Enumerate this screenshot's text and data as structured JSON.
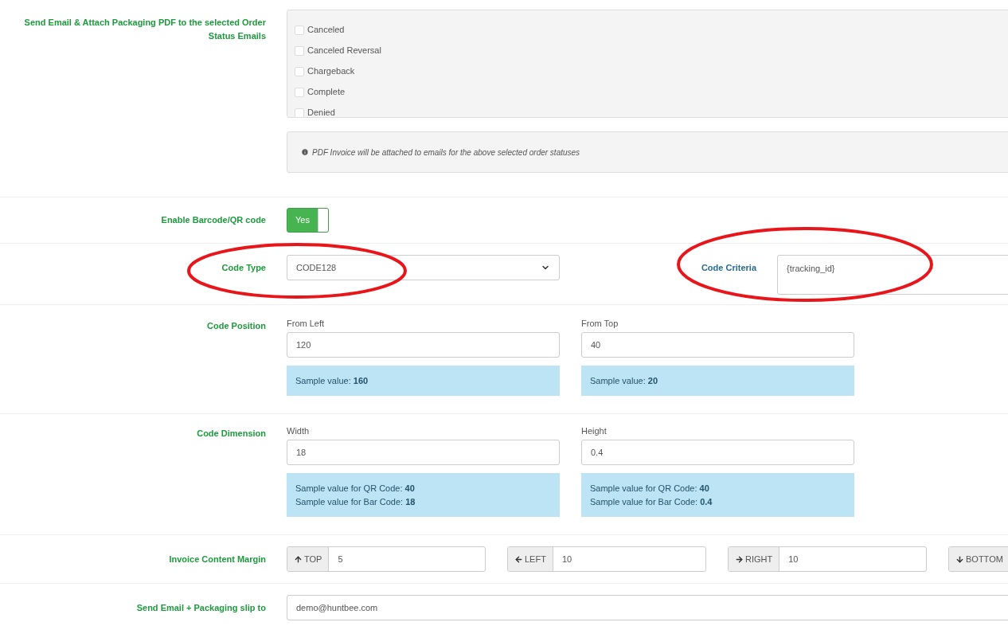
{
  "order_status_emails": {
    "label": "Send Email & Attach Packaging PDF to the selected Order Status Emails",
    "statuses": [
      {
        "label": "Canceled",
        "checked": false
      },
      {
        "label": "Canceled Reversal",
        "checked": false
      },
      {
        "label": "Chargeback",
        "checked": false
      },
      {
        "label": "Complete",
        "checked": false
      },
      {
        "label": "Denied",
        "checked": false
      }
    ],
    "info": "PDF Invoice will be attached to emails for the above selected order statuses"
  },
  "enable_barcode": {
    "label": "Enable Barcode/QR code",
    "toggle_text": "Yes",
    "on": true
  },
  "code_type": {
    "label": "Code Type",
    "value": "CODE128",
    "circled": true
  },
  "code_criteria": {
    "label": "Code Criteria",
    "value": "{tracking_id}",
    "circled": true
  },
  "code_position": {
    "label": "Code Position",
    "fields": [
      {
        "label": "From Left",
        "value": "120",
        "hints": [
          "Sample value: **160**"
        ]
      },
      {
        "label": "From Top",
        "value": "40",
        "hints": [
          "Sample value: **20**"
        ]
      }
    ]
  },
  "code_dimension": {
    "label": "Code Dimension",
    "fields": [
      {
        "label": "Width",
        "value": "18",
        "hints": [
          "Sample value for QR Code: **40**",
          "Sample value for Bar Code: **18**"
        ]
      },
      {
        "label": "Height",
        "value": "0.4",
        "hints": [
          "Sample value for QR Code: **40**",
          "Sample value for Bar Code: **0.4**"
        ]
      }
    ]
  },
  "invoice_margin": {
    "label": "Invoice Content Margin",
    "sides": [
      {
        "kind": "up",
        "label": "TOP",
        "value": "5"
      },
      {
        "kind": "left",
        "label": "LEFT",
        "value": "10"
      },
      {
        "kind": "right",
        "label": "RIGHT",
        "value": "10"
      },
      {
        "kind": "down",
        "label": "BOTTOM"
      }
    ]
  },
  "send_email_to": {
    "label": "Send Email + Packaging slip to",
    "value": "demo@huntbee.com"
  }
}
